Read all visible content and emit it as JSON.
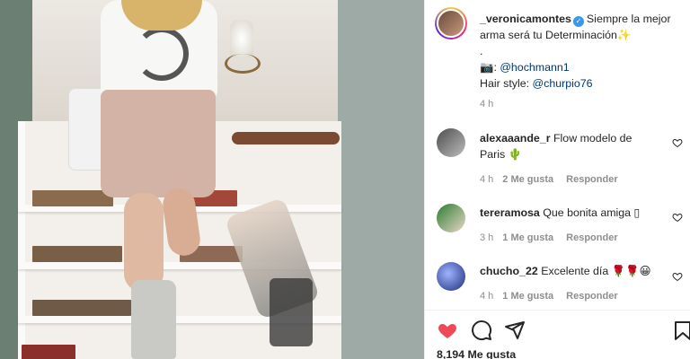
{
  "post": {
    "author": "_veronicamontes",
    "caption_line1": "Siempre la mejor",
    "caption_line2": "arma será tu Determinación",
    "caption_dot": ".",
    "photo_credit_link": "@hochmann1",
    "hair_label": "Hair style:",
    "hair_link": "@churpio76",
    "time": "4 h"
  },
  "comments": [
    {
      "user": "alexaaande_r",
      "text": "Flow modelo de",
      "text2": "Paris",
      "time": "4 h",
      "likes": "2 Me gusta",
      "reply": "Responder"
    },
    {
      "user": "tereramosa",
      "text": "Que bonita amiga",
      "glyph": "▯",
      "time": "3 h",
      "likes": "1 Me gusta",
      "reply": "Responder"
    },
    {
      "user": "chucho_22",
      "text": "Excelente día",
      "time": "4 h",
      "likes": "1 Me gusta",
      "reply": "Responder"
    }
  ],
  "footer": {
    "likes_count": "8,194 Me gusta"
  },
  "colors": {
    "like_red": "#ed4956",
    "link_blue": "#00376b",
    "verified_blue": "#3897f0",
    "muted_gray": "#8e8e8e"
  },
  "icons": [
    "verified-badge-icon",
    "camera-icon",
    "sparkles-icon",
    "heart-icon",
    "comment-icon",
    "share-icon",
    "bookmark-icon",
    "rose-icon",
    "smile-icon",
    "cactus-icon"
  ]
}
